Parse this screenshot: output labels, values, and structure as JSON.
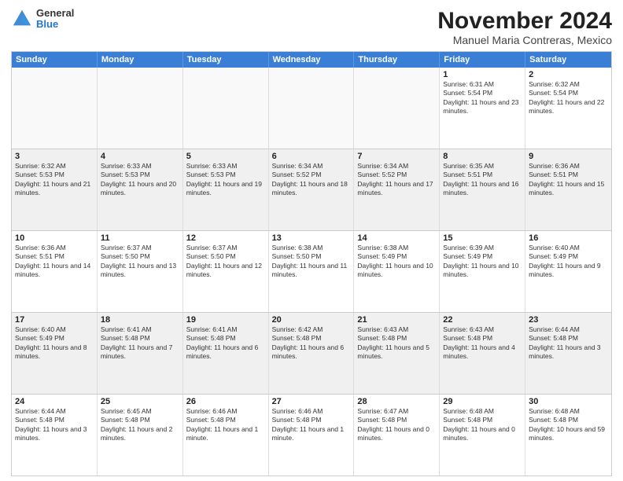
{
  "header": {
    "logo_general": "General",
    "logo_blue": "Blue",
    "title": "November 2024",
    "subtitle": "Manuel Maria Contreras, Mexico"
  },
  "calendar": {
    "days_of_week": [
      "Sunday",
      "Monday",
      "Tuesday",
      "Wednesday",
      "Thursday",
      "Friday",
      "Saturday"
    ],
    "weeks": [
      [
        {
          "day": "",
          "empty": true
        },
        {
          "day": "",
          "empty": true
        },
        {
          "day": "",
          "empty": true
        },
        {
          "day": "",
          "empty": true
        },
        {
          "day": "",
          "empty": true
        },
        {
          "day": "1",
          "info": "Sunrise: 6:31 AM\nSunset: 5:54 PM\nDaylight: 11 hours and 23 minutes."
        },
        {
          "day": "2",
          "info": "Sunrise: 6:32 AM\nSunset: 5:54 PM\nDaylight: 11 hours and 22 minutes."
        }
      ],
      [
        {
          "day": "3",
          "info": "Sunrise: 6:32 AM\nSunset: 5:53 PM\nDaylight: 11 hours and 21 minutes."
        },
        {
          "day": "4",
          "info": "Sunrise: 6:33 AM\nSunset: 5:53 PM\nDaylight: 11 hours and 20 minutes."
        },
        {
          "day": "5",
          "info": "Sunrise: 6:33 AM\nSunset: 5:53 PM\nDaylight: 11 hours and 19 minutes."
        },
        {
          "day": "6",
          "info": "Sunrise: 6:34 AM\nSunset: 5:52 PM\nDaylight: 11 hours and 18 minutes."
        },
        {
          "day": "7",
          "info": "Sunrise: 6:34 AM\nSunset: 5:52 PM\nDaylight: 11 hours and 17 minutes."
        },
        {
          "day": "8",
          "info": "Sunrise: 6:35 AM\nSunset: 5:51 PM\nDaylight: 11 hours and 16 minutes."
        },
        {
          "day": "9",
          "info": "Sunrise: 6:36 AM\nSunset: 5:51 PM\nDaylight: 11 hours and 15 minutes."
        }
      ],
      [
        {
          "day": "10",
          "info": "Sunrise: 6:36 AM\nSunset: 5:51 PM\nDaylight: 11 hours and 14 minutes."
        },
        {
          "day": "11",
          "info": "Sunrise: 6:37 AM\nSunset: 5:50 PM\nDaylight: 11 hours and 13 minutes."
        },
        {
          "day": "12",
          "info": "Sunrise: 6:37 AM\nSunset: 5:50 PM\nDaylight: 11 hours and 12 minutes."
        },
        {
          "day": "13",
          "info": "Sunrise: 6:38 AM\nSunset: 5:50 PM\nDaylight: 11 hours and 11 minutes."
        },
        {
          "day": "14",
          "info": "Sunrise: 6:38 AM\nSunset: 5:49 PM\nDaylight: 11 hours and 10 minutes."
        },
        {
          "day": "15",
          "info": "Sunrise: 6:39 AM\nSunset: 5:49 PM\nDaylight: 11 hours and 10 minutes."
        },
        {
          "day": "16",
          "info": "Sunrise: 6:40 AM\nSunset: 5:49 PM\nDaylight: 11 hours and 9 minutes."
        }
      ],
      [
        {
          "day": "17",
          "info": "Sunrise: 6:40 AM\nSunset: 5:49 PM\nDaylight: 11 hours and 8 minutes."
        },
        {
          "day": "18",
          "info": "Sunrise: 6:41 AM\nSunset: 5:48 PM\nDaylight: 11 hours and 7 minutes."
        },
        {
          "day": "19",
          "info": "Sunrise: 6:41 AM\nSunset: 5:48 PM\nDaylight: 11 hours and 6 minutes."
        },
        {
          "day": "20",
          "info": "Sunrise: 6:42 AM\nSunset: 5:48 PM\nDaylight: 11 hours and 6 minutes."
        },
        {
          "day": "21",
          "info": "Sunrise: 6:43 AM\nSunset: 5:48 PM\nDaylight: 11 hours and 5 minutes."
        },
        {
          "day": "22",
          "info": "Sunrise: 6:43 AM\nSunset: 5:48 PM\nDaylight: 11 hours and 4 minutes."
        },
        {
          "day": "23",
          "info": "Sunrise: 6:44 AM\nSunset: 5:48 PM\nDaylight: 11 hours and 3 minutes."
        }
      ],
      [
        {
          "day": "24",
          "info": "Sunrise: 6:44 AM\nSunset: 5:48 PM\nDaylight: 11 hours and 3 minutes."
        },
        {
          "day": "25",
          "info": "Sunrise: 6:45 AM\nSunset: 5:48 PM\nDaylight: 11 hours and 2 minutes."
        },
        {
          "day": "26",
          "info": "Sunrise: 6:46 AM\nSunset: 5:48 PM\nDaylight: 11 hours and 1 minute."
        },
        {
          "day": "27",
          "info": "Sunrise: 6:46 AM\nSunset: 5:48 PM\nDaylight: 11 hours and 1 minute."
        },
        {
          "day": "28",
          "info": "Sunrise: 6:47 AM\nSunset: 5:48 PM\nDaylight: 11 hours and 0 minutes."
        },
        {
          "day": "29",
          "info": "Sunrise: 6:48 AM\nSunset: 5:48 PM\nDaylight: 11 hours and 0 minutes."
        },
        {
          "day": "30",
          "info": "Sunrise: 6:48 AM\nSunset: 5:48 PM\nDaylight: 10 hours and 59 minutes."
        }
      ]
    ]
  }
}
